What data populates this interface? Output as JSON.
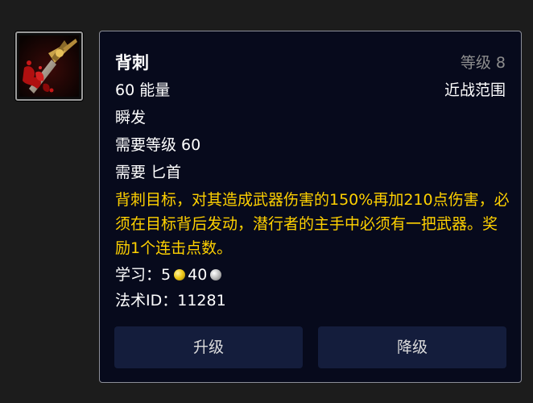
{
  "spell": {
    "icon": "backstab-dagger-icon",
    "name": "背刺",
    "rank": "等级 8",
    "cost": "60 能量",
    "range": "近战范围",
    "cast_time": "瞬发",
    "required_level": "需要等级 60",
    "requires": "需要 匕首",
    "description": "背刺目标，对其造成武器伤害的150%再加210点伤害，必须在目标背后发动，潜行者的主手中必须有一把武器。奖励1个连击点数。",
    "learn_label": "学习：",
    "learn_gold": "5",
    "learn_silver": "40",
    "spell_id_label": "法术ID：",
    "spell_id": "11281"
  },
  "buttons": {
    "upgrade": "升级",
    "downgrade": "降级"
  },
  "colors": {
    "description": "#ffd100",
    "rank": "#8d8d8d",
    "tooltip_bg": "#070a1c",
    "button_bg": "#141d3c"
  }
}
